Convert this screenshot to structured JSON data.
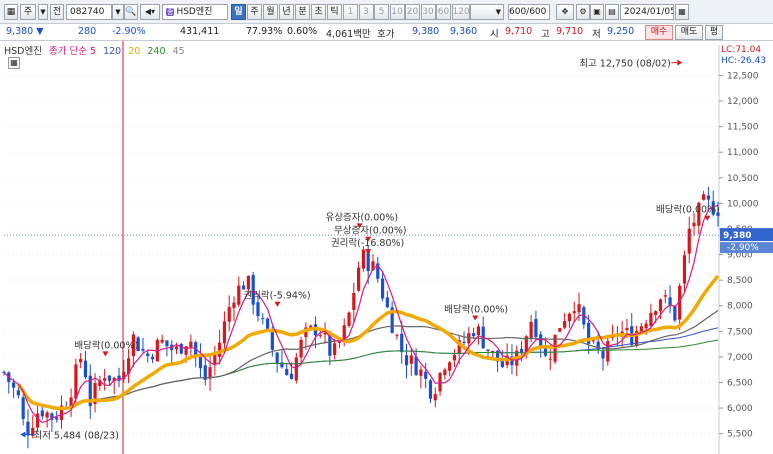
{
  "toolbar": {
    "period_letter": "주",
    "jeon": "전",
    "stock_code": "082740",
    "stock_name": "HSD엔진",
    "stock_badge": "종",
    "periods": [
      "일",
      "주",
      "월",
      "년",
      "분",
      "초",
      "틱"
    ],
    "selected_period": "일",
    "minute_options": [
      "1",
      "3",
      "5",
      "10",
      "20",
      "30",
      "60",
      "120"
    ],
    "bar_count": "600/600",
    "date": "2024/01/05"
  },
  "info": {
    "price": "9,380",
    "change": "280",
    "change_pct": "-2.90%",
    "volume": "431,411",
    "turnover_pct": "77.93%",
    "pct2": "0.60%",
    "amount": "4,061백만",
    "ask_label": "호가",
    "ask": "9,380",
    "bid": "9,360",
    "open_label": "시",
    "open": "9,710",
    "high_label": "고",
    "high": "9,710",
    "low_label": "저",
    "low": "9,250",
    "buy_btn": "매수",
    "sell_btn": "매도",
    "eval_btn": "평"
  },
  "legend": {
    "name": "HSD엔진",
    "ma_label": "종가 단순 5",
    "ma120": "120",
    "ma20": "20",
    "ma240": "240",
    "ma45": "45"
  },
  "colors": {
    "up": "#d8171d",
    "down": "#1a4fcf",
    "ma5": "#d81b86",
    "ma20": "#f2a900",
    "ma45": "#666666",
    "ma120": "#3752c8",
    "ma240": "#2e8b2e",
    "cursor": "#cc2222",
    "current_price": "#3366cc"
  },
  "chart_data": {
    "type": "candlestick",
    "y_range": [
      5200,
      12900
    ],
    "y_ticks": [
      5500,
      6000,
      6500,
      7000,
      7500,
      8000,
      8500,
      9000,
      9500,
      10000,
      10500,
      11000,
      11500,
      12000,
      12500
    ],
    "right_info": {
      "lc": "LC:71.04",
      "hc": "HC:-26.43"
    },
    "current_price": {
      "value": 9380,
      "label": "9,380",
      "pct": "-2.90%"
    },
    "annotations": [
      {
        "text": "최고 12,750 (08/02)",
        "pos": 0.943,
        "value": 12750,
        "kind": "high"
      },
      {
        "text": "최저 5,484 (08/23)",
        "pos": 0.03,
        "value": 5484,
        "kind": "low"
      },
      {
        "text": "배당락(0.00%)",
        "pos": 0.142,
        "value": 7050,
        "kind": "event"
      },
      {
        "text": "권리락(-5.94%)",
        "pos": 0.383,
        "value": 8020,
        "kind": "event"
      },
      {
        "text": "유상증자(0.00%)",
        "pos": 0.498,
        "value": 9550,
        "kind": "event"
      },
      {
        "text": "무상증자(0.00%)",
        "pos": 0.51,
        "value": 9290,
        "kind": "event"
      },
      {
        "text": "권리락(-16.80%)",
        "pos": 0.51,
        "value": 9050,
        "kind": "event"
      },
      {
        "text": "배당락(0.00%)",
        "pos": 0.66,
        "value": 7750,
        "kind": "event"
      },
      {
        "text": "배당락(0.00%)",
        "pos": 0.985,
        "value": 9700,
        "kind": "event"
      }
    ],
    "close_path": [
      [
        0,
        6700
      ],
      [
        0.02,
        6200
      ],
      [
        0.03,
        5500
      ],
      [
        0.05,
        6000
      ],
      [
        0.07,
        5800
      ],
      [
        0.09,
        6200
      ],
      [
        0.11,
        7100
      ],
      [
        0.12,
        6100
      ],
      [
        0.14,
        6700
      ],
      [
        0.16,
        6500
      ],
      [
        0.18,
        7400
      ],
      [
        0.2,
        7000
      ],
      [
        0.22,
        7300
      ],
      [
        0.24,
        7100
      ],
      [
        0.26,
        7400
      ],
      [
        0.28,
        6500
      ],
      [
        0.3,
        7200
      ],
      [
        0.32,
        8200
      ],
      [
        0.34,
        8500
      ],
      [
        0.36,
        7700
      ],
      [
        0.38,
        7000
      ],
      [
        0.4,
        6600
      ],
      [
        0.42,
        7400
      ],
      [
        0.44,
        7600
      ],
      [
        0.46,
        7000
      ],
      [
        0.48,
        7600
      ],
      [
        0.5,
        9000
      ],
      [
        0.52,
        8700
      ],
      [
        0.54,
        7800
      ],
      [
        0.56,
        7000
      ],
      [
        0.58,
        6800
      ],
      [
        0.6,
        6300
      ],
      [
        0.62,
        7000
      ],
      [
        0.64,
        7200
      ],
      [
        0.66,
        7600
      ],
      [
        0.68,
        7100
      ],
      [
        0.7,
        6800
      ],
      [
        0.72,
        7000
      ],
      [
        0.74,
        7800
      ],
      [
        0.76,
        6900
      ],
      [
        0.78,
        7700
      ],
      [
        0.8,
        8100
      ],
      [
        0.82,
        7200
      ],
      [
        0.84,
        7000
      ],
      [
        0.86,
        7500
      ],
      [
        0.88,
        7400
      ],
      [
        0.9,
        7800
      ],
      [
        0.92,
        8200
      ],
      [
        0.94,
        7800
      ],
      [
        0.96,
        9500
      ],
      [
        0.98,
        10000
      ],
      [
        1.0,
        9900
      ]
    ],
    "ma_note": "moving averages drawn as smoothed curves: 5(pink candle-like), 20(orange), 45(gray), 120(blue), 240(green)"
  }
}
